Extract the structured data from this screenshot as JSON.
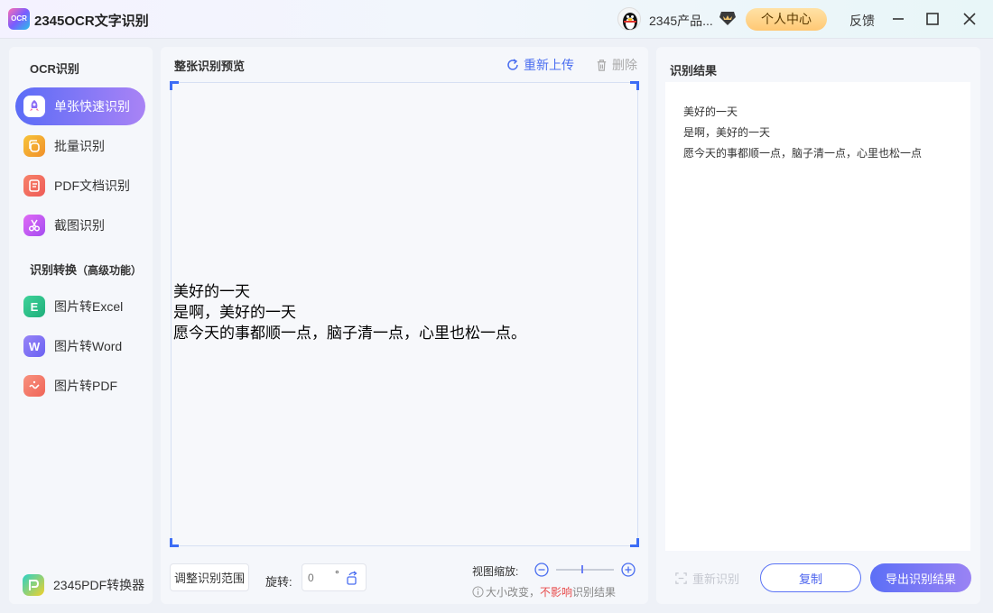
{
  "app": {
    "logo_text": "OCR",
    "title": "2345OCR文字识别"
  },
  "topbar": {
    "user_name": "2345产品...",
    "user_center": "个人中心",
    "feedback": "反馈"
  },
  "sidebar": {
    "section_ocr": "OCR识别",
    "items_ocr": [
      {
        "label": "单张快速识别",
        "icon": "rocket-icon",
        "color": "#ffffff"
      },
      {
        "label": "批量识别",
        "icon": "batch-icon",
        "color": "#f7b23a"
      },
      {
        "label": "PDF文档识别",
        "icon": "pdf-doc-icon",
        "color": "#f26b5e"
      },
      {
        "label": "截图识别",
        "icon": "scissors-icon",
        "color": "#c25cf2"
      }
    ],
    "section_convert": "识别转换",
    "section_convert_sub": "（高级功能）",
    "items_convert": [
      {
        "label": "图片转Excel",
        "icon": "excel-icon",
        "color": "#2fbd8a",
        "glyph": "E"
      },
      {
        "label": "图片转Word",
        "icon": "word-icon",
        "color": "#7a6ff5",
        "glyph": "W"
      },
      {
        "label": "图片转PDF",
        "icon": "pdf-icon",
        "color": "#f2776a",
        "glyph": "~"
      }
    ],
    "pdf_converter": "2345PDF转换器"
  },
  "preview": {
    "title": "整张识别预览",
    "reupload": "重新上传",
    "delete": "删除",
    "lines": [
      "美好的一天",
      "是啊，美好的一天",
      "愿今天的事都顺一点，脑子清一点，心里也松一点。"
    ],
    "adjust_range": "调整识别范围",
    "rotate_label": "旋转:",
    "rotate_value": "0",
    "degree": "°",
    "zoom_label": "视图缩放:",
    "zoom_level": 0.45,
    "zoom_note_prefix": "大小改变，",
    "zoom_note_warn": "不影响",
    "zoom_note_suffix": "识别结果"
  },
  "result": {
    "title": "识别结果",
    "lines": [
      "美好的一天",
      "是啊，美好的一天",
      "愿今天的事都顺一点，脑子清一点，心里也松一点"
    ],
    "re_recognize": "重新识别",
    "copy": "复制",
    "export": "导出识别结果"
  },
  "colors": {
    "accent": "#4a6ef0",
    "active_gradient_start": "#5b6cf7",
    "active_gradient_end": "#a983f5",
    "warning": "#e84b4b"
  }
}
